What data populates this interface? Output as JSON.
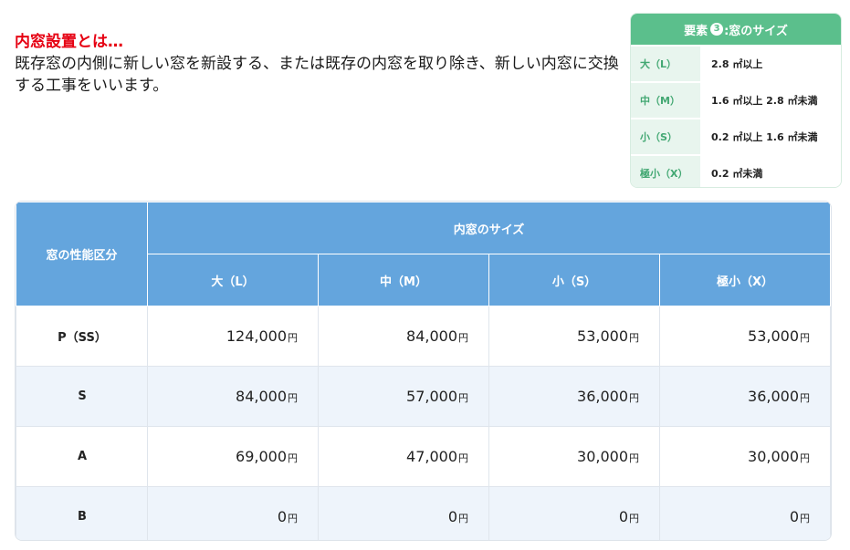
{
  "intro": {
    "title": "内窓設置とは…",
    "text": "既存窓の内側に新しい窓を新設する、または既存の内窓を取り除き、新しい内窓に交換する工事をいいます。"
  },
  "size_box": {
    "title_prefix": "要素",
    "title_num": "3",
    "title_suffix": ":窓のサイズ",
    "rows": [
      {
        "key": "大（L）",
        "value": "2.8 ㎡以上"
      },
      {
        "key": "中（M）",
        "value": "1.6 ㎡以上 2.8 ㎡未満"
      },
      {
        "key": "小（S）",
        "value": "0.2 ㎡以上 1.6 ㎡未満"
      },
      {
        "key": "極小（X）",
        "value": "0.2 ㎡未満"
      }
    ]
  },
  "price_table": {
    "corner": "窓の性能区分",
    "group_header": "内窓のサイズ",
    "columns": [
      "大（L）",
      "中（M）",
      "小（S）",
      "極小（X）"
    ],
    "currency": "円",
    "rows": [
      {
        "label": "P（SS）",
        "values": [
          "124,000",
          "84,000",
          "53,000",
          "53,000"
        ]
      },
      {
        "label": "S",
        "values": [
          "84,000",
          "57,000",
          "36,000",
          "36,000"
        ]
      },
      {
        "label": "A",
        "values": [
          "69,000",
          "47,000",
          "30,000",
          "30,000"
        ]
      },
      {
        "label": "B",
        "values": [
          "0",
          "0",
          "0",
          "0"
        ]
      }
    ]
  }
}
